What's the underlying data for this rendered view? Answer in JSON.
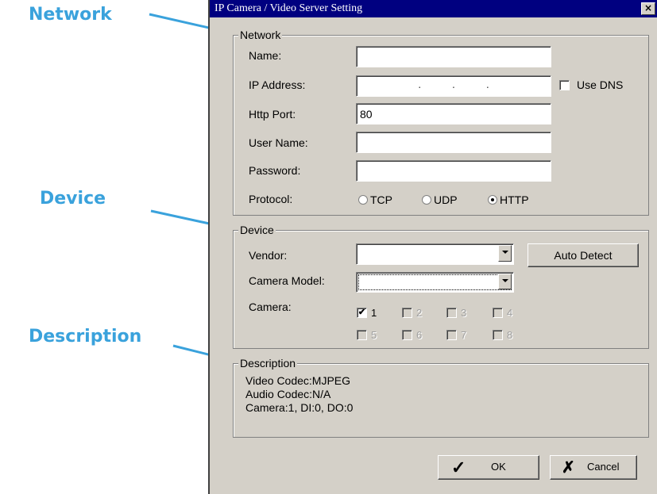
{
  "annotations": {
    "network": "Network",
    "device": "Device",
    "description": "Description"
  },
  "dialog": {
    "title": "IP Camera / Video Server Setting",
    "close_glyph": "×"
  },
  "network": {
    "legend": "Network",
    "name_label": "Name:",
    "name_value": "",
    "ip_label": "IP Address:",
    "ip_dots": ".          .          .",
    "use_dns_label": "Use DNS",
    "use_dns_checked": false,
    "http_port_label": "Http Port:",
    "http_port_value": "80",
    "user_label": "User Name:",
    "user_value": "",
    "password_label": "Password:",
    "password_value": "",
    "protocol_label": "Protocol:",
    "protocols": [
      "TCP",
      "UDP",
      "HTTP"
    ],
    "selected_protocol": "HTTP"
  },
  "device": {
    "legend": "Device",
    "vendor_label": "Vendor:",
    "vendor_value": "",
    "auto_detect_label": "Auto Detect",
    "model_label": "Camera Model:",
    "model_value": "",
    "camera_label": "Camera:",
    "cameras": [
      "1",
      "2",
      "3",
      "4",
      "5",
      "6",
      "7",
      "8"
    ],
    "camera_checked": "1",
    "check_glyph": "✔"
  },
  "description": {
    "legend": "Description",
    "lines": [
      "Video Codec:MJPEG",
      "Audio Codec:N/A",
      "Camera:1, DI:0, DO:0"
    ]
  },
  "buttons": {
    "ok_label": "OK",
    "cancel_label": "Cancel",
    "ok_icon": "✓",
    "cancel_icon": "✗"
  },
  "colors": {
    "annotation": "#3aa2dc",
    "titlebar": "#000080",
    "dialog_bg": "#d4d0c8"
  }
}
